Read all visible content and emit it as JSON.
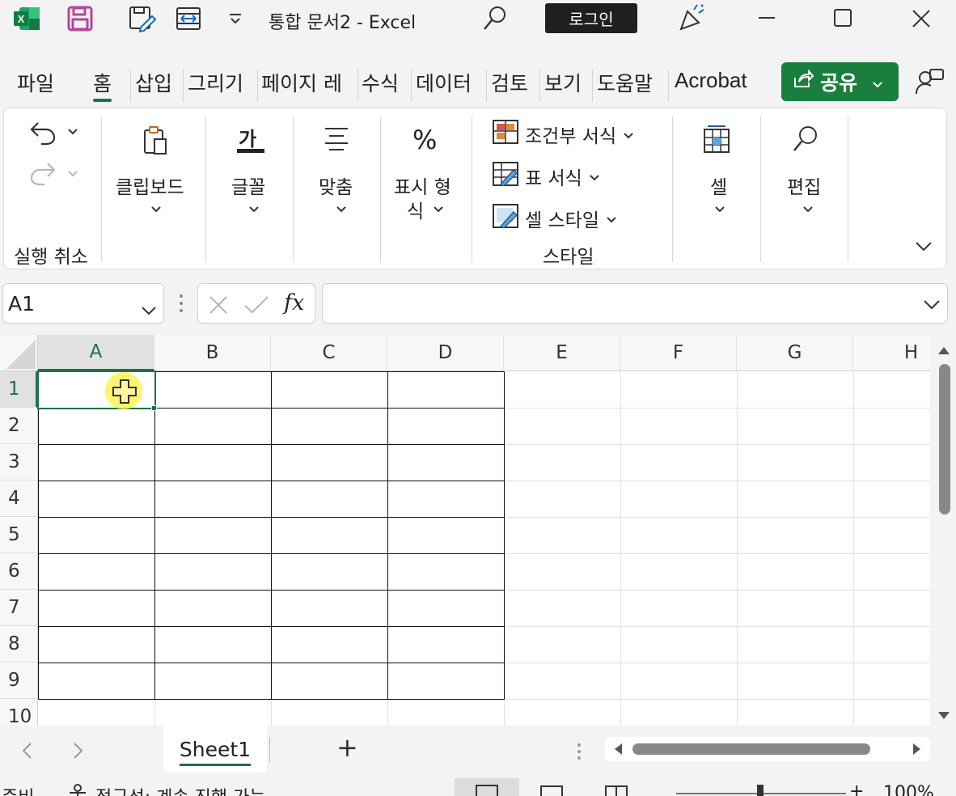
{
  "titlebar": {
    "doc_title": "통합 문서2  -  Excel",
    "login_label": "로그인"
  },
  "tabs": [
    {
      "label": "파일"
    },
    {
      "label": "홈",
      "active": true
    },
    {
      "label": "삽입"
    },
    {
      "label": "그리기"
    },
    {
      "label": "페이지 레"
    },
    {
      "label": "수식"
    },
    {
      "label": "데이터"
    },
    {
      "label": "검토"
    },
    {
      "label": "보기"
    },
    {
      "label": "도움말"
    },
    {
      "label": "Acrobat"
    }
  ],
  "share": {
    "label": "공유"
  },
  "ribbon": {
    "undo_group_label": "실행 취소",
    "clipboard_label": "클립보드",
    "font_label": "글꼴",
    "font_icon_text": "가",
    "align_label": "맞춤",
    "number_label_line1": "표시 형",
    "number_label_line2": "식",
    "number_icon_text": "%",
    "conditional_format_label": "조건부 서식",
    "table_format_label": "표 서식",
    "cell_style_label": "셀 스타일",
    "styles_group_label": "스타일",
    "cells_label": "셀",
    "editing_label": "편집"
  },
  "formula_bar": {
    "name_box_value": "A1",
    "fx_label": "fx",
    "formula_value": ""
  },
  "grid": {
    "columns": [
      "A",
      "B",
      "C",
      "D",
      "E",
      "F",
      "G",
      "H"
    ],
    "rows": [
      "1",
      "2",
      "3",
      "4",
      "5",
      "6",
      "7",
      "8",
      "9",
      "10"
    ],
    "selected_cell": "A1",
    "bordered_range": "A1:D9"
  },
  "sheets": {
    "tabs": [
      {
        "label": "Sheet1",
        "active": true
      }
    ],
    "add_label": "+"
  },
  "status": {
    "ready_text": "준비",
    "accessibility_text": "접근성: 계속 진행 가능",
    "zoom_text": "100%"
  },
  "colors": {
    "accent_green": "#1e7145",
    "share_green": "#1a7f3c",
    "excel_icon_green": "#107c41",
    "save_icon_purple": "#b4469b"
  }
}
